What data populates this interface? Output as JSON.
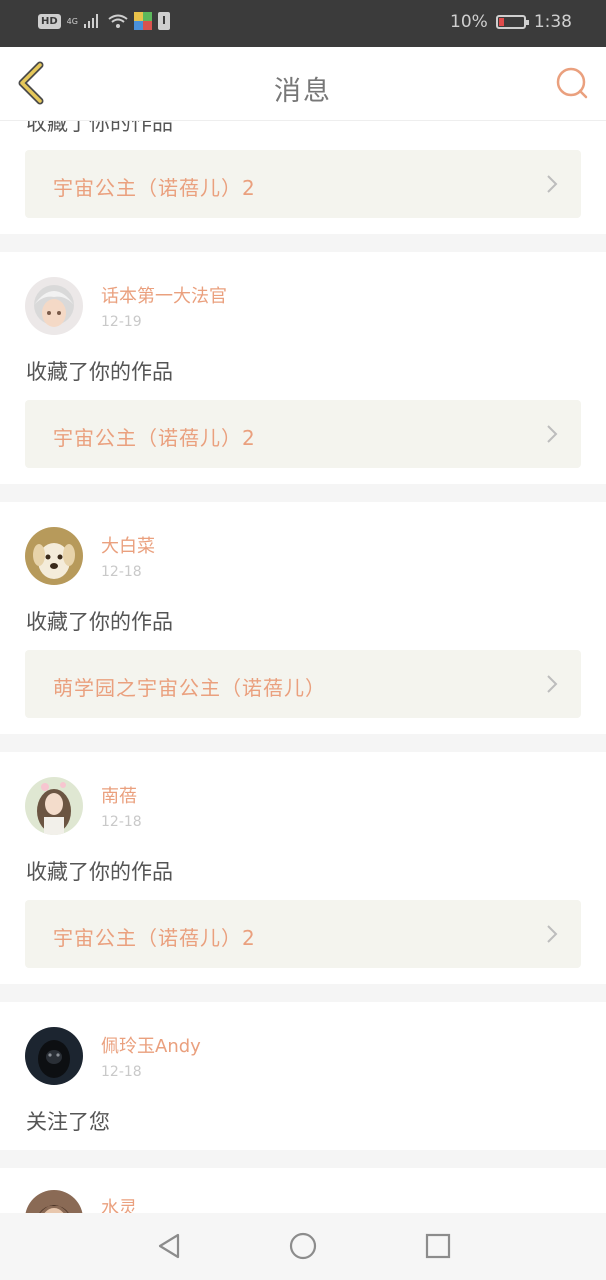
{
  "status_bar": {
    "hd": "HD",
    "network": "4G",
    "battery_percent": "10%",
    "time": "1:38"
  },
  "header": {
    "title": "消息",
    "back_icon": "chevron-left-icon",
    "search_icon": "search-icon"
  },
  "partial_top": {
    "action": "收藏了你的作品",
    "work_title": "宇宙公主（诺蓓儿）2"
  },
  "messages": [
    {
      "user": "话本第一大法官",
      "date": "12-19",
      "action": "收藏了你的作品",
      "work_title": "宇宙公主（诺蓓儿）2"
    },
    {
      "user": "大白菜",
      "date": "12-18",
      "action": "收藏了你的作品",
      "work_title": "萌学园之宇宙公主（诺蓓儿）"
    },
    {
      "user": "南蓓",
      "date": "12-18",
      "action": "收藏了你的作品",
      "work_title": "宇宙公主（诺蓓儿）2"
    },
    {
      "user": "佩玲玉Andy",
      "date": "12-18",
      "action": "关注了您"
    }
  ],
  "partial_bottom": {
    "user": "水灵"
  },
  "colors": {
    "accent": "#eaa07e",
    "back_arrow": "#e6c85a",
    "link_bg": "#f4f4ee",
    "divider": "#f5f5f5"
  },
  "nav": {
    "back": "triangle-back-icon",
    "home": "circle-home-icon",
    "recent": "square-recent-icon"
  }
}
